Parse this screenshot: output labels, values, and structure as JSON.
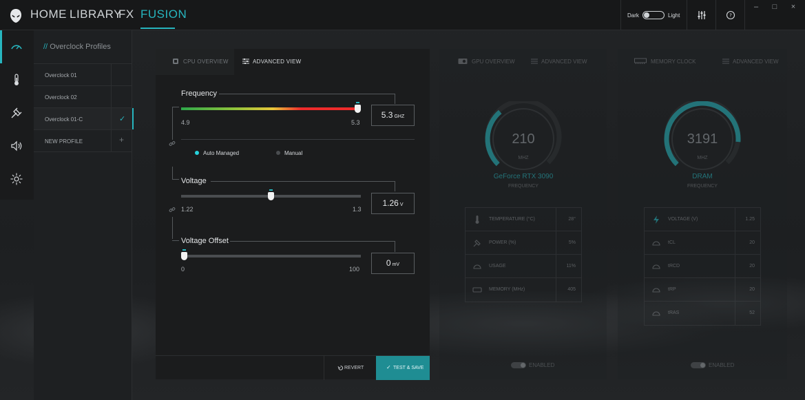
{
  "nav": {
    "tabs": [
      {
        "label": "HOME"
      },
      {
        "label": "LIBRARY"
      },
      {
        "label": "FX"
      },
      {
        "label": "FUSION"
      }
    ],
    "active_tab": "FUSION",
    "accent_color": "#27b6bf"
  },
  "theme": {
    "dark_label": "Dark",
    "light_label": "Light",
    "selected": "Dark"
  },
  "topbar_icons": [
    "mixer-icon",
    "help-icon"
  ],
  "window_controls": [
    "minimize-icon",
    "maximize-icon",
    "close-icon"
  ],
  "rail": {
    "items": [
      {
        "icon": "gauge-icon",
        "active": true
      },
      {
        "icon": "thermometer-icon",
        "active": false
      },
      {
        "icon": "plug-icon",
        "active": false
      },
      {
        "icon": "speaker-icon",
        "active": false
      },
      {
        "icon": "light-icon",
        "active": false
      }
    ]
  },
  "profiles": {
    "title_prefix": "//",
    "title": "Overclock Profiles",
    "items": [
      {
        "label": "Overclock 01",
        "active": false
      },
      {
        "label": "Overclock 02",
        "active": false
      },
      {
        "label": "Overclock 01-C",
        "active": true
      },
      {
        "label": "NEW PROFILE",
        "active": false
      }
    ]
  },
  "cpu_panel": {
    "tabs": [
      {
        "label": "CPU OVERVIEW",
        "active": false
      },
      {
        "label": "ADVANCED VIEW",
        "active": true
      }
    ],
    "frequency": {
      "label": "Frequency",
      "min": "4.9",
      "max": "5.3",
      "value": "5.3",
      "unit": "GHZ",
      "fill_fraction": 1.0,
      "mode_options": [
        {
          "label": "Auto Managed",
          "selected": true
        },
        {
          "label": "Manual",
          "selected": false
        }
      ]
    },
    "voltage": {
      "label": "Voltage",
      "min": "1.22",
      "max": "1.3",
      "value": "1.26",
      "unit": "V",
      "fill_fraction": 0.5
    },
    "voltage_offset": {
      "label": "Voltage Offset",
      "min": "0",
      "max": "100",
      "value": "0",
      "unit": "mV",
      "fill_fraction": 0.0
    },
    "revert_label": "REVERT",
    "save_label": "TEST & SAVE"
  },
  "gpu_panel": {
    "tabs": [
      {
        "label": "GPU OVERVIEW"
      },
      {
        "label": "ADVANCED VIEW"
      }
    ],
    "gauge": {
      "value": "210",
      "unit": "MHZ",
      "name": "GeForce RTX 3090",
      "sub": "FREQUENCY",
      "fill_fraction": 0.35
    },
    "stats": [
      {
        "icon": "thermometer-icon",
        "label": "TEMPERATURE (°C)",
        "value": "28°"
      },
      {
        "icon": "plug-icon",
        "label": "POWER (%)",
        "value": "5%"
      },
      {
        "icon": "gauge-icon",
        "label": "USAGE",
        "value": "11%"
      },
      {
        "icon": "memory-icon",
        "label": "MEMORY (MHz)",
        "value": "405"
      }
    ],
    "enabled_label": "ENABLED"
  },
  "memory_panel": {
    "tabs": [
      {
        "label": "MEMORY CLOCK"
      },
      {
        "label": "ADVANCED VIEW"
      }
    ],
    "gauge": {
      "value": "3191",
      "unit": "MHZ",
      "name": "DRAM",
      "sub": "FREQUENCY",
      "fill_fraction": 0.85
    },
    "stats": [
      {
        "icon": "bolt-icon",
        "label": "VOLTAGE (V)",
        "value": "1.25"
      },
      {
        "icon": "gauge-icon",
        "label": "tCL",
        "value": "20"
      },
      {
        "icon": "gauge-icon",
        "label": "tRCD",
        "value": "20"
      },
      {
        "icon": "gauge-icon",
        "label": "tRP",
        "value": "20"
      },
      {
        "icon": "gauge-icon",
        "label": "tRAS",
        "value": "52"
      }
    ],
    "enabled_label": "ENABLED"
  }
}
